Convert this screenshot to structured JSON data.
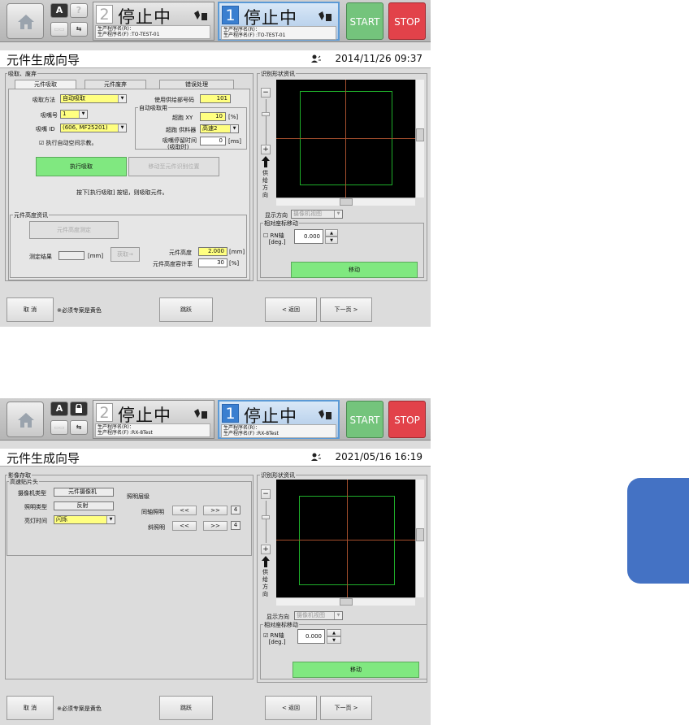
{
  "screens": [
    {
      "header": {
        "btn1": "A",
        "btn2": "?",
        "btn3": "",
        "prog2": {
          "num": "2",
          "status": "停止中",
          "line1": "生产程序名(R)：",
          "line2": "生产程序名(F) :TO-TEST-01"
        },
        "prog1": {
          "num": "1",
          "status": "停止中",
          "line1": "生产程序名(R)：",
          "line2": "生产程序名(F) :TO-TEST-01"
        },
        "start": "START",
        "stop": "STOP"
      },
      "title": "元件生成向导",
      "datetime": "2014/11/26 09:37",
      "left_group": "吸取、废弃",
      "tabs": [
        "元件吸取",
        "元件废弃",
        "错误处理"
      ],
      "pick_method_label": "吸取方法",
      "pick_method": "自动吸取",
      "nozzle_no_label": "吸嘴号",
      "nozzle_no": "1",
      "nozzle_id_label": "吸嘴 ID",
      "nozzle_id": "(606, MF25201)",
      "auto_teach_label": "执行自动空间示教。",
      "feeder_no_label": "使用供给部号码",
      "feeder_no": "101",
      "auto_pick_group": "自动吸取用",
      "pass_xy_label": "超跑 XY",
      "pass_xy": "10",
      "pass_xy_unit": "[%]",
      "pass_feeder_label": "超跑 供料器",
      "pass_feeder": "高速2",
      "dwell_label": "吸嘴停留时间",
      "dwell_sub": "(吸取时)",
      "dwell": "0",
      "dwell_unit": "[ms]",
      "exec_pick": "执行吸取",
      "move_recog": "移动至元件识别位置",
      "hint": "按下[执行吸取] 按钮，则吸取元件。",
      "height_group": "元件高度资讯",
      "height_measure": "元件高度测定",
      "measure_result_label": "测定结果",
      "mm": "[mm]",
      "take_btn": "获取→",
      "part_height_label": "元件高度",
      "part_height": "2.000",
      "part_height_unit": "[mm]",
      "tolerance_label": "元件高度容许率",
      "tolerance": "30",
      "tolerance_unit": "[%]",
      "recog_group": "识别形状资讯",
      "supply_dir": [
        "供",
        "给",
        "方",
        "向"
      ],
      "display_dir_label": "显示方向",
      "display_dir": "摄像机视图",
      "rel_move_group": "相对座标移动",
      "rn_label": "RN轴",
      "rn_unit": "[deg.]",
      "rn_value": "0.000",
      "move_btn": "移动",
      "cancel": "取 消",
      "required_note": "※必须专案是黄色",
      "skip": "跳跃",
      "back": "< 返回",
      "next": "下一页 >"
    },
    {
      "header": {
        "btn1": "A",
        "btn2": "",
        "btn3": "",
        "prog2": {
          "num": "2",
          "status": "停止中",
          "line1": "生产程序名(R)：",
          "line2": "生产程序名(F) :RX-8Test"
        },
        "prog1": {
          "num": "1",
          "status": "停止中",
          "line1": "生产程序名(R)：",
          "line2": "生产程序名(F) :RX-8Test"
        },
        "start": "START",
        "stop": "STOP"
      },
      "title": "元件生成向导",
      "datetime": "2021/05/16 16:19",
      "left_group": "影像存取",
      "head_group": "高速贴片头",
      "camera_type_label": "摄像机类型",
      "camera_type": "元件摄像机",
      "light_type_label": "照明类型",
      "light_type": "反射",
      "light_time_label": "亮灯时间",
      "light_time": "闪烁",
      "light_level_label": "照明层级",
      "coax_label": "同轴照明",
      "coax_value": "4",
      "oblique_label": "斜照明",
      "oblique_value": "4",
      "dec": "<<",
      "inc": ">>",
      "recog_group": "识别形状资讯",
      "supply_dir": [
        "供",
        "给",
        "方",
        "向"
      ],
      "display_dir_label": "显示方向",
      "display_dir": "摄像机视图",
      "rel_move_group": "相对座标移动",
      "rn_label": "RN轴",
      "rn_unit": "[deg.]",
      "rn_value": "0.000",
      "move_btn": "移动",
      "cancel": "取 消",
      "required_note": "※必须专案是黄色",
      "skip": "跳跃",
      "back": "< 返回",
      "next": "下一页 >"
    }
  ]
}
